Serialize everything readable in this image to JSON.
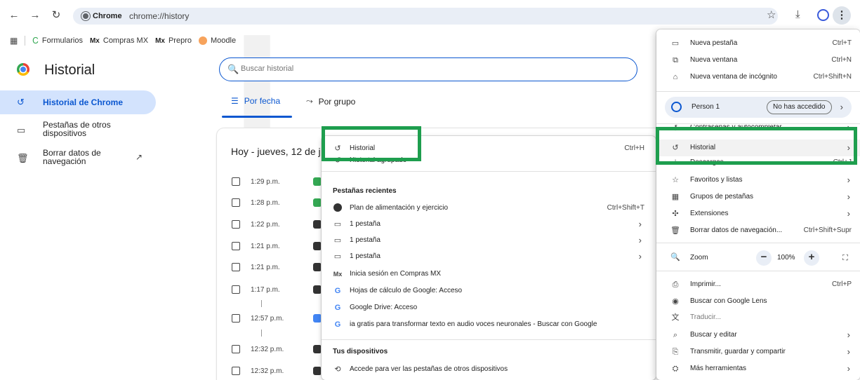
{
  "topbar": {
    "site_chip": "Chrome",
    "url": "chrome://history"
  },
  "bookmarks": [
    {
      "label": "Formularios",
      "icon": "formularios-icon"
    },
    {
      "label": "Compras MX",
      "icon": "compras-mx-icon",
      "prefix": "Mx"
    },
    {
      "label": "Prepro",
      "icon": "prepro-icon",
      "prefix": "Mx"
    },
    {
      "label": "Moodle",
      "icon": "moodle-icon"
    }
  ],
  "sidebar": {
    "title": "Historial",
    "items": [
      {
        "label": "Historial de Chrome"
      },
      {
        "label": "Pestañas de otros dispositivos"
      },
      {
        "label": "Borrar datos de navegación"
      }
    ]
  },
  "search": {
    "placeholder": "Buscar historial"
  },
  "tabs": [
    {
      "label": "Por fecha"
    },
    {
      "label": "Por grupo"
    }
  ],
  "history": {
    "day_title": "Hoy - jueves, 12 de ju",
    "rows": [
      {
        "time": "1:29 p.m.",
        "favicon": "formularios"
      },
      {
        "time": "1:28 p.m.",
        "favicon": "formularios"
      },
      {
        "time": "1:22 p.m.",
        "favicon": "angular"
      },
      {
        "time": "1:21 p.m.",
        "favicon": "angular"
      },
      {
        "time": "1:21 p.m.",
        "favicon": "angular"
      },
      {
        "time": "1:17 p.m.",
        "favicon": "angular"
      },
      {
        "time": "12:57 p.m.",
        "favicon": "google"
      },
      {
        "time": "12:32 p.m.",
        "favicon": "angular"
      },
      {
        "time": "12:32 p.m.",
        "favicon": "angular"
      }
    ]
  },
  "submenu": {
    "historial": {
      "label": "Historial",
      "shortcut": "Ctrl+H"
    },
    "historial_agrupado": "Historial agrupado",
    "recent_heading": "Pestañas recientes",
    "recent": [
      {
        "label": "Plan de alimentación y ejercicio",
        "shortcut": "Ctrl+Shift+T"
      },
      {
        "label": "1 pestaña"
      },
      {
        "label": "1 pestaña"
      },
      {
        "label": "1 pestaña"
      },
      {
        "label": "Inicia sesión en Compras MX"
      },
      {
        "label": "Hojas de cálculo de Google: Acceso"
      },
      {
        "label": "Google Drive: Acceso"
      },
      {
        "label": "ia gratis para transformar texto en audio voces neuronales - Buscar con Google"
      }
    ],
    "devices_heading": "Tus dispositivos",
    "devices_item": "Accede para ver las pestañas de otros dispositivos"
  },
  "mainmenu": {
    "new_tab": {
      "label": "Nueva pestaña",
      "shortcut": "Ctrl+T"
    },
    "new_window": {
      "label": "Nueva ventana",
      "shortcut": "Ctrl+N"
    },
    "incognito": {
      "label": "Nueva ventana de incógnito",
      "shortcut": "Ctrl+Shift+N"
    },
    "person": {
      "label": "Person 1",
      "badge": "No has accedido"
    },
    "passwords": "Contraseñas y autocompletar",
    "history": "Historial",
    "downloads": {
      "label": "Descargas",
      "shortcut": "Ctrl+J"
    },
    "favorites": "Favoritos y listas",
    "tab_groups": "Grupos de pestañas",
    "extensions": "Extensiones",
    "clear_data": {
      "label": "Borrar datos de navegación...",
      "shortcut": "Ctrl+Shift+Supr"
    },
    "zoom": {
      "label": "Zoom",
      "value": "100%"
    },
    "print": {
      "label": "Imprimir...",
      "shortcut": "Ctrl+P"
    },
    "lens": "Buscar con Google Lens",
    "translate": "Traducir...",
    "find_edit": "Buscar y editar",
    "cast": "Transmitir, guardar y compartir",
    "more_tools": "Más herramientas"
  },
  "colors": {
    "accent": "#0b57d0",
    "highlight": "#1e9e4e"
  }
}
